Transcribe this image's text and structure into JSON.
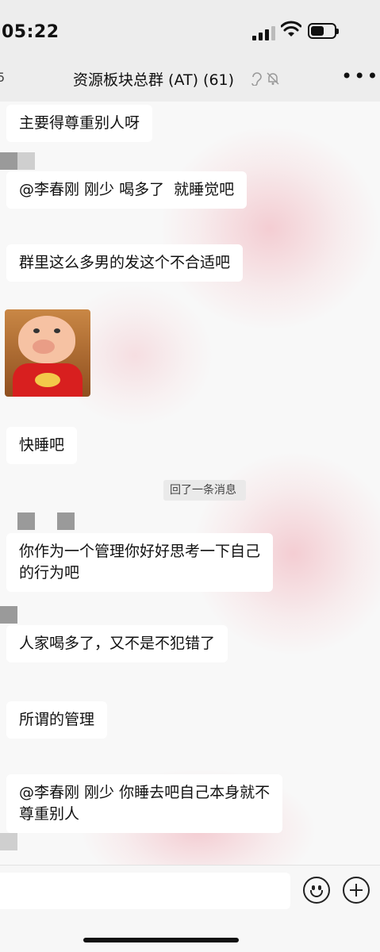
{
  "status_bar": {
    "time": "05:22"
  },
  "nav": {
    "back_badge": "5",
    "title": "资源板块总群 (AT) (61)",
    "more": "•••"
  },
  "messages": [
    {
      "type": "text",
      "text": "主要得尊重别人呀"
    },
    {
      "type": "text",
      "text": "@李春刚 刚少 喝多了  就睡觉吧"
    },
    {
      "type": "text",
      "text": "群里这么多男的发这个不合适吧"
    },
    {
      "type": "sticker",
      "icon": "pig-sticker"
    },
    {
      "type": "text",
      "text": "快睡吧"
    },
    {
      "type": "system",
      "text": "回了一条消息"
    },
    {
      "type": "text",
      "text": "你作为一个管理你好好思考一下自己\n的行为吧"
    },
    {
      "type": "text",
      "text": "人家喝多了，又不是不犯错了"
    },
    {
      "type": "text",
      "text": "所谓的管理"
    },
    {
      "type": "text",
      "text": "@李春刚 刚少 你睡去吧自己本身就不\n尊重别人"
    }
  ],
  "input": {
    "value": "",
    "emoji_icon": "emoji-icon",
    "plus_icon": "plus-circle-icon"
  }
}
